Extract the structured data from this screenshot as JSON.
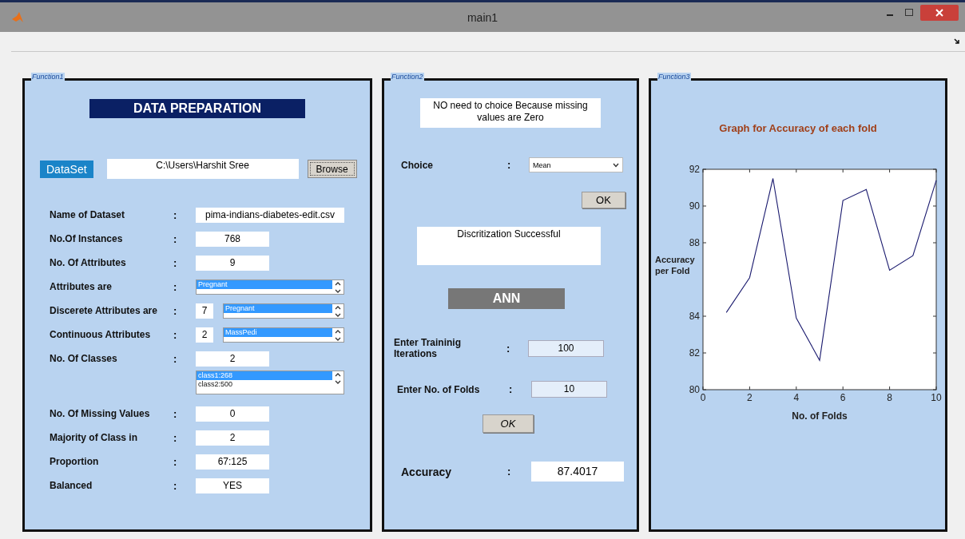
{
  "window": {
    "title": "main1"
  },
  "function1": {
    "title": "Function1",
    "header": "DATA PREPARATION",
    "dataset_label": "DataSet",
    "dataset_path": "C:\\Users\\Harshit Sree",
    "browse_button": "Browse",
    "rows": [
      {
        "kind": "field",
        "label": "Name of Dataset",
        "colon": ":",
        "value": "pima-indians-diabetes-edit.csv"
      },
      {
        "kind": "field",
        "label": "No.Of Instances",
        "colon": ":",
        "value": "768"
      },
      {
        "kind": "field",
        "label": "No. Of Attributes",
        "colon": ":",
        "value": "9"
      },
      {
        "kind": "list",
        "label": "Attributes are",
        "colon": ":",
        "items": [
          {
            "text": "Pregnant",
            "selected": true
          }
        ]
      },
      {
        "kind": "count_list",
        "label": "Discerete Attributes are",
        "colon": ":",
        "count": "7",
        "items": [
          {
            "text": "Pregnant",
            "selected": true
          }
        ]
      },
      {
        "kind": "count_list",
        "label": "Continuous Attributes",
        "colon": ":",
        "count": "2",
        "items": [
          {
            "text": "MassPedi",
            "selected": true
          }
        ]
      },
      {
        "kind": "field",
        "label": "No. Of Classes",
        "colon": ":",
        "value": "2"
      },
      {
        "kind": "list_only",
        "items": [
          {
            "text": "class1:268",
            "selected": true
          },
          {
            "text": "class2:500",
            "selected": false
          }
        ]
      },
      {
        "kind": "field",
        "label": "No. Of Missing Values",
        "colon": ":",
        "value": "0"
      },
      {
        "kind": "field",
        "label": "Majority of Class in",
        "colon": ":",
        "value": "2"
      },
      {
        "kind": "field",
        "label": "Proportion",
        "colon": ":",
        "value": "67:125"
      },
      {
        "kind": "field",
        "label": "Balanced",
        "colon": ":",
        "value": "YES"
      }
    ]
  },
  "function2": {
    "title": "Function2",
    "message": "NO need to choice Because missing values are Zero",
    "choice_label": "Choice",
    "choice_colon": ":",
    "choice_value": "Mean",
    "ok_button": "OK",
    "status": "Discritization Successful",
    "ann_header": "ANN",
    "training_label": "Enter Traininig Iterations",
    "training_colon": ":",
    "training_value": "100",
    "folds_label": "Enter No. of Folds",
    "folds_colon": ":",
    "folds_value": "10",
    "ok_button_2": "OK",
    "accuracy_label": "Accuracy",
    "accuracy_colon": ":",
    "accuracy_value": "87.4017"
  },
  "function3": {
    "title": "Function3",
    "chart_data": {
      "type": "line",
      "title": "Graph for Accuracy of each fold",
      "xlabel": "No. of Folds",
      "ylabel": "Accuracy per Fold",
      "x": [
        1,
        2,
        3,
        4,
        5,
        6,
        7,
        8,
        9,
        10
      ],
      "series": [
        {
          "color": "#1a1a6e",
          "values": [
            84.2,
            86.1,
            91.5,
            83.9,
            81.6,
            90.3,
            90.9,
            86.5,
            87.3,
            91.4
          ]
        }
      ],
      "xlim": [
        0,
        10
      ],
      "ylim": [
        80,
        92
      ],
      "xticks": [
        0,
        2,
        4,
        6,
        8,
        10
      ],
      "yticks": [
        80,
        82,
        84,
        88,
        90,
        92
      ]
    }
  }
}
